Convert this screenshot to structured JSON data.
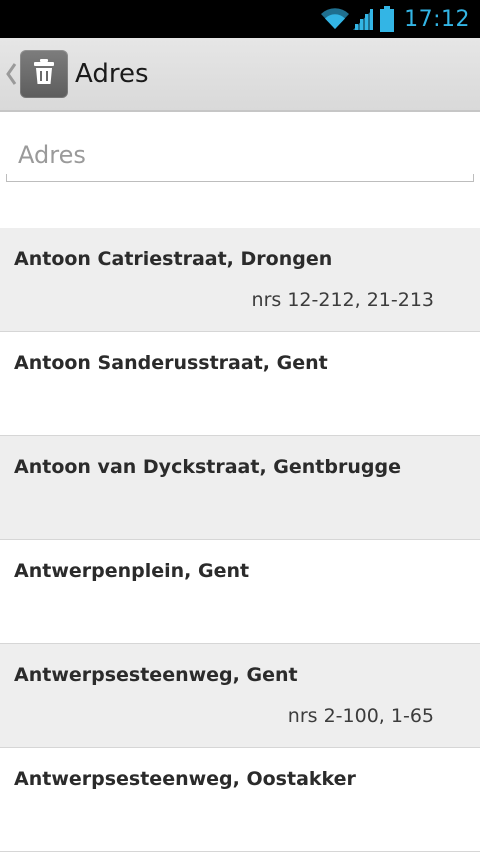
{
  "status_bar": {
    "time": "17:12",
    "accent_color": "#33b5e5",
    "icons": [
      "wifi-icon",
      "signal-icon",
      "battery-icon"
    ]
  },
  "action_bar": {
    "title": "Adres",
    "app_icon": "trash-icon",
    "back_icon": "chevron-left-icon"
  },
  "search": {
    "placeholder": "Adres",
    "value": ""
  },
  "results": [
    {
      "street": "Antoon Catriestraat, Drongen",
      "numbers": "nrs 12-212, 21-213"
    },
    {
      "street": "Antoon Sanderusstraat, Gent",
      "numbers": ""
    },
    {
      "street": "Antoon van Dyckstraat, Gentbrugge",
      "numbers": ""
    },
    {
      "street": "Antwerpenplein, Gent",
      "numbers": ""
    },
    {
      "street": "Antwerpsesteenweg, Gent",
      "numbers": "nrs 2-100, 1-65"
    },
    {
      "street": "Antwerpsesteenweg, Oostakker",
      "numbers": ""
    }
  ]
}
